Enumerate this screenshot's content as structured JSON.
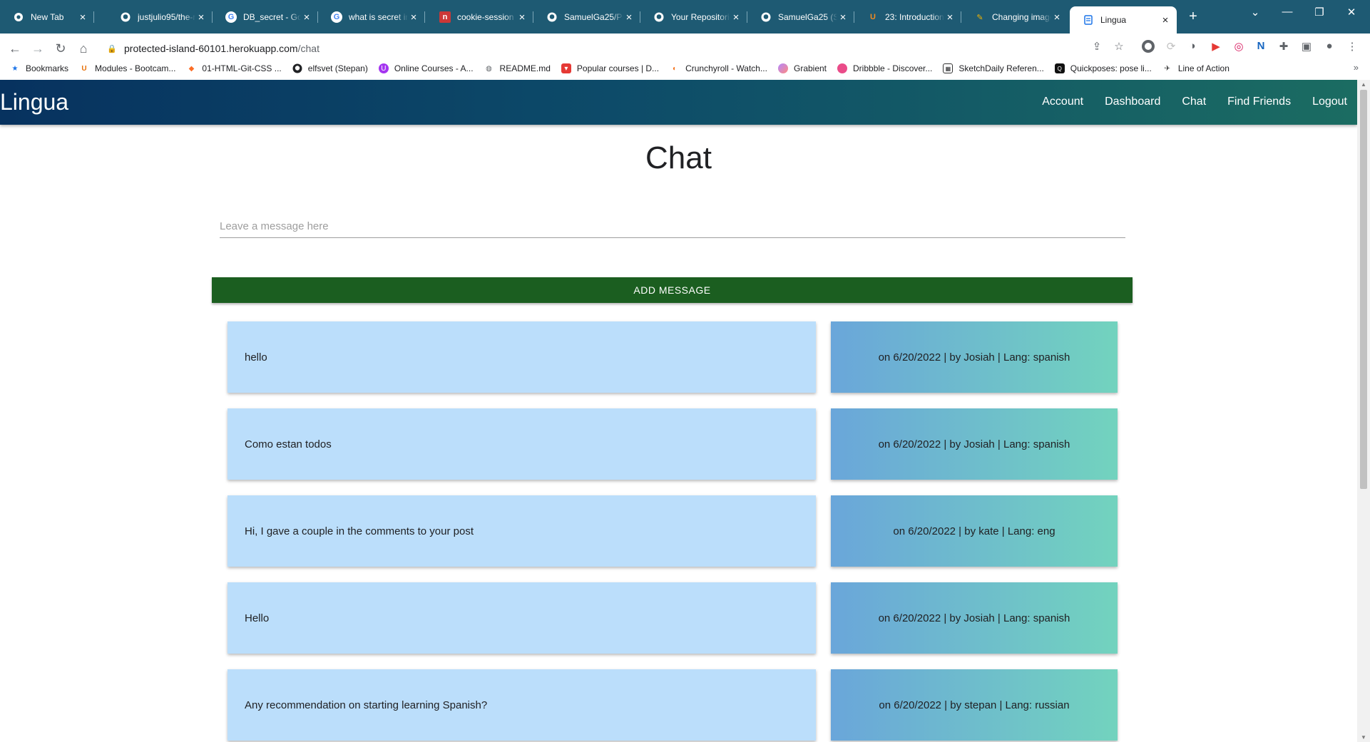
{
  "browser": {
    "tabs": [
      {
        "title": "New Tab",
        "icon": "chrome-icon"
      },
      {
        "title": "justjulio95/the-r",
        "icon": "github-icon"
      },
      {
        "title": "DB_secret - Goo",
        "icon": "google-icon"
      },
      {
        "title": "what is secret in",
        "icon": "google-icon"
      },
      {
        "title": "cookie-session -",
        "icon": "npm-icon"
      },
      {
        "title": "SamuelGa25/Pr",
        "icon": "github-icon"
      },
      {
        "title": "Your Repositorie",
        "icon": "github-icon"
      },
      {
        "title": "SamuelGa25 (Sa",
        "icon": "github-icon"
      },
      {
        "title": "23: Introduction",
        "icon": "bootcamp-icon"
      },
      {
        "title": "Changing image",
        "icon": "pencil-icon"
      },
      {
        "title": "Lingua",
        "icon": "page-icon",
        "active": true
      }
    ],
    "url_host": "protected-island-60101.herokuapp.com",
    "url_path": "/chat",
    "bookmarks": [
      {
        "label": "Bookmarks",
        "icon": "star-icon",
        "color": "#1a73e8"
      },
      {
        "label": "Modules - Bootcam...",
        "icon": "bootcamp-icon",
        "color": "#e8710a"
      },
      {
        "label": "01-HTML-Git-CSS ...",
        "icon": "gitlab-icon",
        "color": "#fc6d26"
      },
      {
        "label": "elfsvet (Stepan)",
        "icon": "github-icon",
        "color": "#202124"
      },
      {
        "label": "Online Courses - A...",
        "icon": "udemy-icon",
        "color": "#a435f0"
      },
      {
        "label": "README.md",
        "icon": "globe-icon",
        "color": "#5f6368"
      },
      {
        "label": "Popular courses | D...",
        "icon": "domestika-icon",
        "color": "#e53935"
      },
      {
        "label": "Crunchyroll - Watch...",
        "icon": "crunchyroll-icon",
        "color": "#f47521"
      },
      {
        "label": "Grabient",
        "icon": "grabient-icon",
        "color": "#b388ff"
      },
      {
        "label": "Dribbble - Discover...",
        "icon": "dribbble-icon",
        "color": "#ea4c89"
      },
      {
        "label": "SketchDaily Referen...",
        "icon": "sketchdaily-icon",
        "color": "#333333"
      },
      {
        "label": "Quickposes: pose li...",
        "icon": "quickposes-icon",
        "color": "#111111"
      },
      {
        "label": "Line of Action",
        "icon": "line-of-action-icon",
        "color": "#333333"
      }
    ]
  },
  "app": {
    "brand": "Lingua",
    "nav": {
      "account": "Account",
      "dashboard": "Dashboard",
      "chat": "Chat",
      "find_friends": "Find Friends",
      "logout": "Logout"
    },
    "page_title": "Chat",
    "input_placeholder": "Leave a message here",
    "add_button": "ADD MESSAGE",
    "messages": [
      {
        "text": "hello",
        "meta": "on 6/20/2022 | by Josiah | Lang: spanish"
      },
      {
        "text": "Como estan todos",
        "meta": "on 6/20/2022 | by Josiah | Lang: spanish"
      },
      {
        "text": "Hi, I gave a couple in the comments to your post",
        "meta": "on 6/20/2022 | by kate | Lang: eng"
      },
      {
        "text": "Hello",
        "meta": "on 6/20/2022 | by Josiah | Lang: spanish"
      },
      {
        "text": "Any recommendation on starting learning Spanish?",
        "meta": "on 6/20/2022 | by stepan | Lang: russian"
      }
    ],
    "colors": {
      "nav_gradient_start": "#07325f",
      "nav_gradient_end": "#1b6c62",
      "button": "#1b5e20",
      "message_bg": "#bbdefb",
      "meta_gradient_start": "#6aa6da",
      "meta_gradient_end": "#72d3be"
    }
  }
}
